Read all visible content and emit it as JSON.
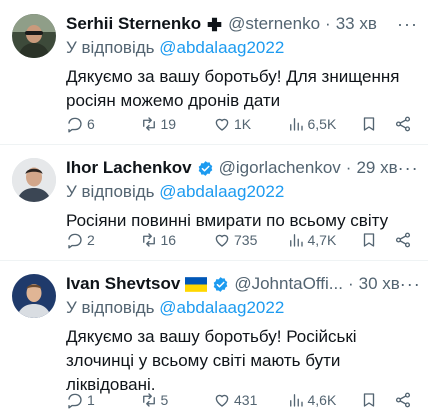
{
  "tweets": [
    {
      "author_name": "Serhii Sternenko",
      "badge": "plus-cross",
      "handle": "@sternenko",
      "separator": "·",
      "time": "33 хв",
      "reply_prefix": "У відповідь",
      "reply_to": "@abdalaag2022",
      "text": "Дякуємо за вашу боротьбу! Для знищення росіян можемо дронів дати",
      "replies": "6",
      "reposts": "19",
      "likes": "1K",
      "views": "6,5K"
    },
    {
      "author_name": "Ihor Lachenkov",
      "badge": "verified",
      "handle": "@igorlachenkov",
      "separator": "·",
      "time": "29 хв",
      "reply_prefix": "У відповідь",
      "reply_to": "@abdalaag2022",
      "text": "Росіяни повинні вмирати по всьому світу",
      "replies": "2",
      "reposts": "16",
      "likes": "735",
      "views": "4,7K"
    },
    {
      "author_name": "Ivan Shevtsov",
      "badge": "ukraine-flag-verified",
      "handle": "@JohntaOffi...",
      "separator": "·",
      "time": "30 хв",
      "reply_prefix": "У відповідь",
      "reply_to": "@abdalaag2022",
      "text": "Дякуємо за вашу боротьбу! Російські злочинці у всьому світі мають бути ліквідовані.",
      "replies": "1",
      "reposts": "5",
      "likes": "431",
      "views": "4,6K"
    }
  ],
  "more_glyph": "···",
  "colors": {
    "text": "#0f1419",
    "secondary": "#536471",
    "link": "#1d9bf0",
    "verified": "#1d9bf0",
    "divider": "#eff3f4"
  }
}
